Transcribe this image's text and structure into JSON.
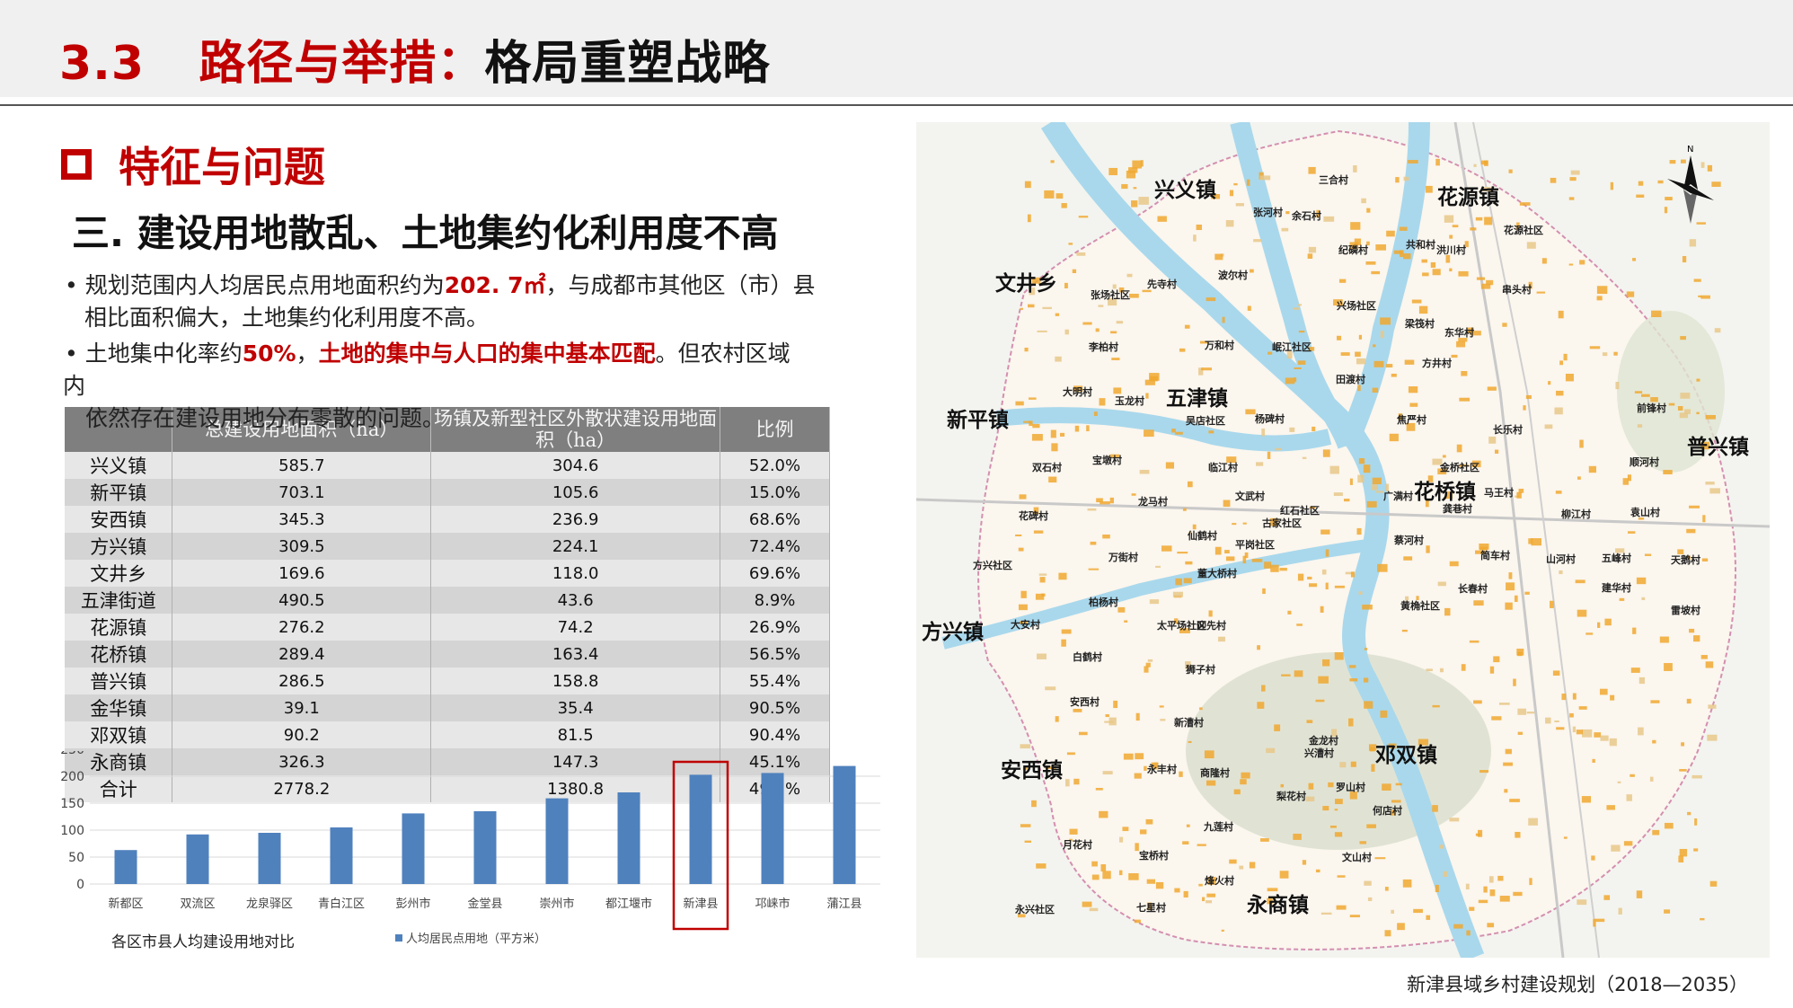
{
  "header": {
    "number": "3.3",
    "title_part1": "路径与举措：",
    "title_part2": "格局重塑战略"
  },
  "section": {
    "heading": "特征与问题",
    "subheading": "三.  建设用地散乱、土地集约化利用度不高"
  },
  "bullets": {
    "b1_prefix": "• 规划范围内人均居民点用地面积约为",
    "b1_value": "202. 7㎡",
    "b1_suffix": "，与成都市其他区（市）县",
    "b1_line2": "相比面积偏大，土地集约化利用度不高。",
    "b2_prefix": "• 土地集中化率约",
    "b2_value": "50%",
    "b2_comma": "，",
    "b2_highlight": "土地的集中与人口的集中基本匹配",
    "b2_suffix": "。但农村区域",
    "b2_line2": "内",
    "b2_line3": "依然存在建设用地分布零散的问题。"
  },
  "table": {
    "headers": [
      "",
      "总建设用地面积（ha）",
      "场镇及新型社区外散状建设用地面积（ha）",
      "比例"
    ],
    "rows": [
      [
        "兴义镇",
        "585.7",
        "304.6",
        "52.0%"
      ],
      [
        "新平镇",
        "703.1",
        "105.6",
        "15.0%"
      ],
      [
        "安西镇",
        "345.3",
        "236.9",
        "68.6%"
      ],
      [
        "方兴镇",
        "309.5",
        "224.1",
        "72.4%"
      ],
      [
        "文井乡",
        "169.6",
        "118.0",
        "69.6%"
      ],
      [
        "五津街道",
        "490.5",
        "43.6",
        "8.9%"
      ],
      [
        "花源镇",
        "276.2",
        "74.2",
        "26.9%"
      ],
      [
        "花桥镇",
        "289.4",
        "163.4",
        "56.5%"
      ],
      [
        "普兴镇",
        "286.5",
        "158.8",
        "55.4%"
      ],
      [
        "金华镇",
        "39.1",
        "35.4",
        "90.5%"
      ],
      [
        "邓双镇",
        "90.2",
        "81.5",
        "90.4%"
      ],
      [
        "永商镇",
        "326.3",
        "147.3",
        "45.1%"
      ],
      [
        "合计",
        "2778.2",
        "1380.8",
        "49.7%"
      ]
    ]
  },
  "chart_data": {
    "type": "bar",
    "title": "各区市县人均建设用地对比",
    "categories": [
      "新都区",
      "双流区",
      "龙泉驿区",
      "青白江区",
      "彭州市",
      "金堂县",
      "崇州市",
      "都江堰市",
      "新津县",
      "邛崃市",
      "蒲江县"
    ],
    "series": [
      {
        "name": "人均居民点用地（平方米）",
        "values": [
          63,
          92,
          95,
          105,
          131,
          135,
          159,
          170,
          202.7,
          206,
          219
        ]
      }
    ],
    "yticks": [
      "0",
      "50",
      "100",
      "150",
      "200",
      "250"
    ],
    "ylim": [
      0,
      250
    ],
    "highlight": "新津县",
    "bar_color": "#4f81bd",
    "highlight_color": "#c00000",
    "legend": "bottom"
  },
  "map": {
    "towns": [
      "兴义镇",
      "花源镇",
      "文井乡",
      "五津镇",
      "新平镇",
      "普兴镇",
      "花桥镇",
      "方兴镇",
      "邓双镇",
      "安西镇",
      "永商镇"
    ],
    "villages": [
      "三合村",
      "张河村",
      "余石村",
      "纪磷村",
      "共和村",
      "洪川村",
      "花源社区",
      "串头村",
      "先寺村",
      "波尔村",
      "张场社区",
      "兴场社区",
      "李柏村",
      "万和村",
      "岷江社区",
      "梁筏村",
      "东华村",
      "方井村",
      "田渡村",
      "大明村",
      "玉龙村",
      "吴店社区",
      "杨碑村",
      "焦严村",
      "长乐村",
      "前锋村",
      "顺河村",
      "双石村",
      "宝墩村",
      "临江村",
      "金桥社区",
      "马王村",
      "广满村",
      "龚巷村",
      "袁山村",
      "柳江村",
      "花碑村",
      "龙马村",
      "文武村",
      "红石社区",
      "古家社区",
      "仙鹤村",
      "平岗社区",
      "蔡河村",
      "简车村",
      "山河村",
      "五峰村",
      "天鹅村",
      "方兴社区",
      "万街村",
      "董大桥村",
      "长春村",
      "建华村",
      "柏杨村",
      "黄桷社区",
      "雷坡村",
      "大安村",
      "太平场社区",
      "迎先村",
      "白鹤村",
      "狮子村",
      "安西村",
      "新漕村",
      "金龙村",
      "兴漕村",
      "永丰村",
      "商隆村",
      "罗山村",
      "梨花村",
      "何店村",
      "九莲村",
      "月花村",
      "宝桥村",
      "文山村",
      "烽火村",
      "永兴社区",
      "七星村"
    ]
  },
  "footer": {
    "text": "新津县域乡村建设规划（2018—2035）"
  },
  "colors": {
    "accent": "#c00000",
    "bar": "#4f81bd",
    "river": "#a9d8ec",
    "settlement": "#f0a830"
  }
}
